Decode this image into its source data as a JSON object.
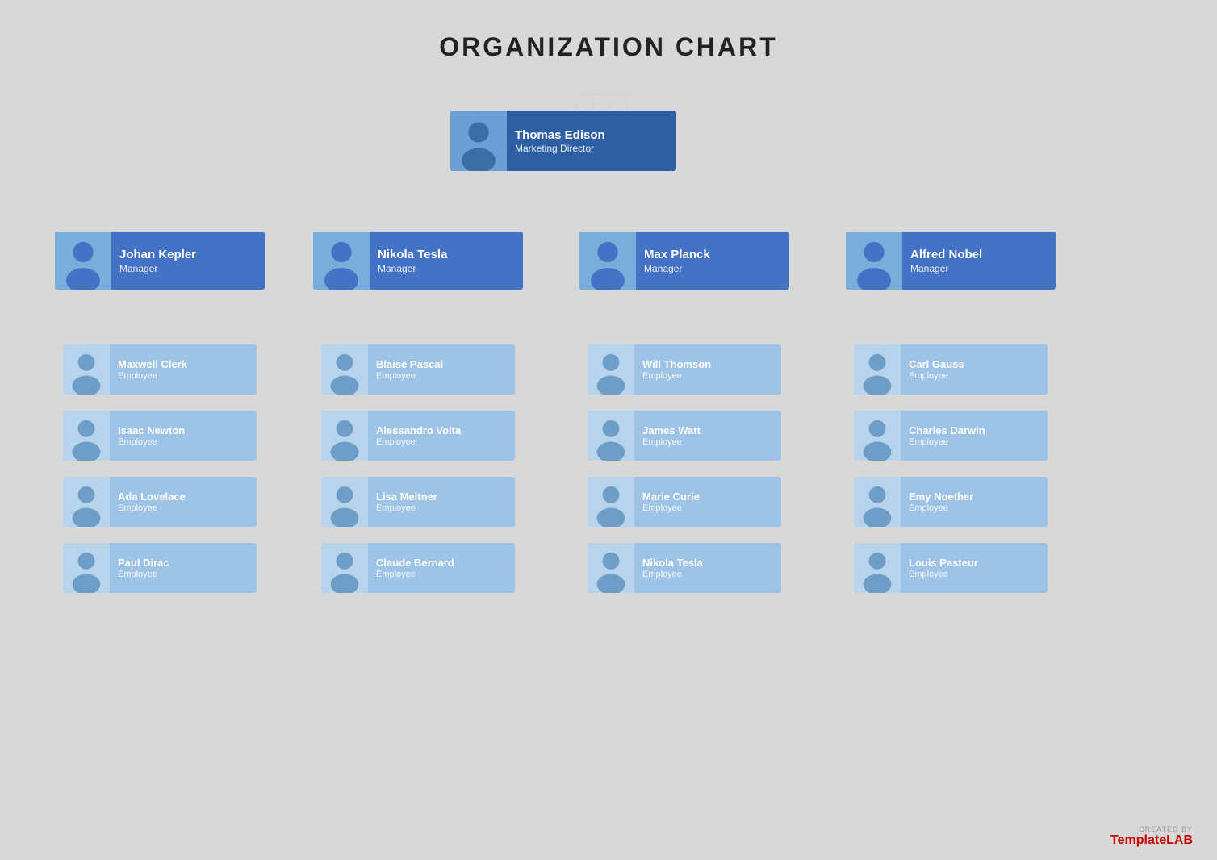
{
  "title": "ORGANIZATION CHART",
  "watermark": {
    "created_by": "CREATED BY",
    "brand_part1": "Template",
    "brand_part2": "LAB"
  },
  "root": {
    "name": "Thomas Edison",
    "role": "Marketing Director"
  },
  "managers": [
    {
      "name": "Johan Kepler",
      "role": "Manager"
    },
    {
      "name": "Nikola Tesla",
      "role": "Manager"
    },
    {
      "name": "Max Planck",
      "role": "Manager"
    },
    {
      "name": "Alfred Nobel",
      "role": "Manager"
    }
  ],
  "employees": [
    [
      {
        "name": "Maxwell Clerk",
        "role": "Employee"
      },
      {
        "name": "Isaac Newton",
        "role": "Employee"
      },
      {
        "name": "Ada Lovelace",
        "role": "Employee"
      },
      {
        "name": "Paul Dirac",
        "role": "Employee"
      }
    ],
    [
      {
        "name": "Blaise Pascal",
        "role": "Employee"
      },
      {
        "name": "Alessandro Volta",
        "role": "Employee"
      },
      {
        "name": "Lisa Meitner",
        "role": "Employee"
      },
      {
        "name": "Claude Bernard",
        "role": "Employee"
      }
    ],
    [
      {
        "name": "Will Thomson",
        "role": "Employee"
      },
      {
        "name": "James Watt",
        "role": "Employee"
      },
      {
        "name": "Marie Curie",
        "role": "Employee"
      },
      {
        "name": "Nikola Tesla",
        "role": "Employee"
      }
    ],
    [
      {
        "name": "Carl Gauss",
        "role": "Employee"
      },
      {
        "name": "Charles Darwin",
        "role": "Employee"
      },
      {
        "name": "Emy Noether",
        "role": "Employee"
      },
      {
        "name": "Louis Pasteur",
        "role": "Employee"
      }
    ]
  ]
}
